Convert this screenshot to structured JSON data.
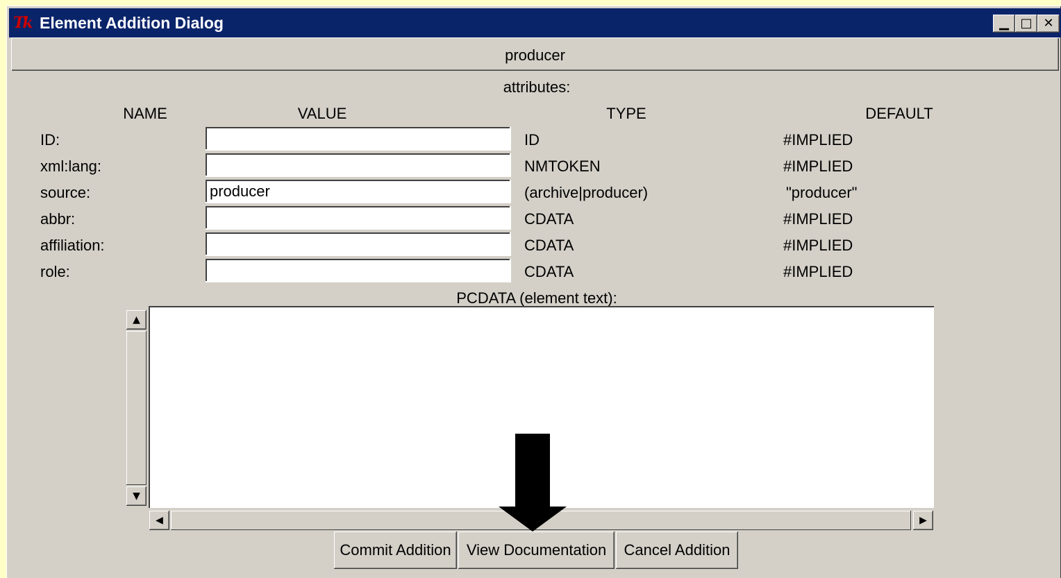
{
  "window": {
    "title": "Element Addition Dialog",
    "controls": {
      "minimize": "▁",
      "maximize": "□",
      "close": "✕"
    }
  },
  "element_name": "producer",
  "attributes_label": "attributes:",
  "columns": {
    "name": "NAME",
    "value": "VALUE",
    "type": "TYPE",
    "default": "DEFAULT"
  },
  "attributes": [
    {
      "name": "ID:",
      "value": "",
      "type": "ID",
      "default": "#IMPLIED"
    },
    {
      "name": "xml:lang:",
      "value": "",
      "type": "NMTOKEN",
      "default": "#IMPLIED"
    },
    {
      "name": "source:",
      "value": "producer",
      "type": "(archive|producer)",
      "default": "\"producer\""
    },
    {
      "name": "abbr:",
      "value": "",
      "type": "CDATA",
      "default": "#IMPLIED"
    },
    {
      "name": "affiliation:",
      "value": "",
      "type": "CDATA",
      "default": "#IMPLIED"
    },
    {
      "name": "role:",
      "value": "",
      "type": "CDATA",
      "default": "#IMPLIED"
    }
  ],
  "pcdata_label": "PCDATA (element text):",
  "pcdata_value": "",
  "buttons": {
    "commit": "Commit Addition",
    "view_docs": "View Documentation",
    "cancel": "Cancel Addition"
  },
  "annotation": {
    "arrow_icon": "down-arrow-icon",
    "color": "#000000"
  },
  "colors": {
    "titlebar": "#0a246a",
    "dialog_bg": "#d4d0c8",
    "desktop_bg": "#ffffc8"
  }
}
